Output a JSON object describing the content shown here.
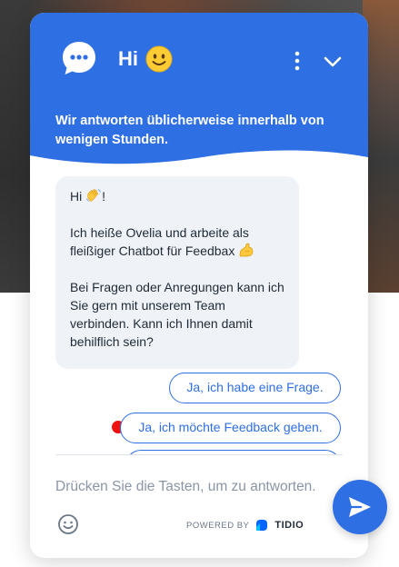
{
  "header": {
    "greeting": "Hi",
    "greeting_emoji": "slightly-smiling-face",
    "subtitle": "Wir antworten üblicherweise innerhalb von wenigen Stunden.",
    "logo_icon": "chat-bubble-icon",
    "menu_icon": "kebab-menu-icon",
    "collapse_icon": "chevron-down-icon"
  },
  "message": {
    "line1_prefix": "Hi",
    "line1_suffix": "!",
    "para2_part1": "Ich heiße Ovelia und arbeite als fleißiger Chatbot für Feedbax",
    "para3": "Bei Fragen oder Anregungen kann ich Sie gern mit unserem Team verbinden. Kann ich Ihnen damit behilflich sein?"
  },
  "options": [
    {
      "label": "Ja, ich habe eine Frage."
    },
    {
      "label": "Ja, ich möchte Feedback geben."
    },
    {
      "label": ""
    }
  ],
  "footer": {
    "input_placeholder": "Drücken Sie die Tasten, um zu antworten.",
    "powered_by": "POWERED BY",
    "brand": "TIDIO"
  },
  "colors": {
    "accent": "#2f6fe4",
    "bubble": "#eff2f6",
    "indicator": "#ee1111"
  }
}
